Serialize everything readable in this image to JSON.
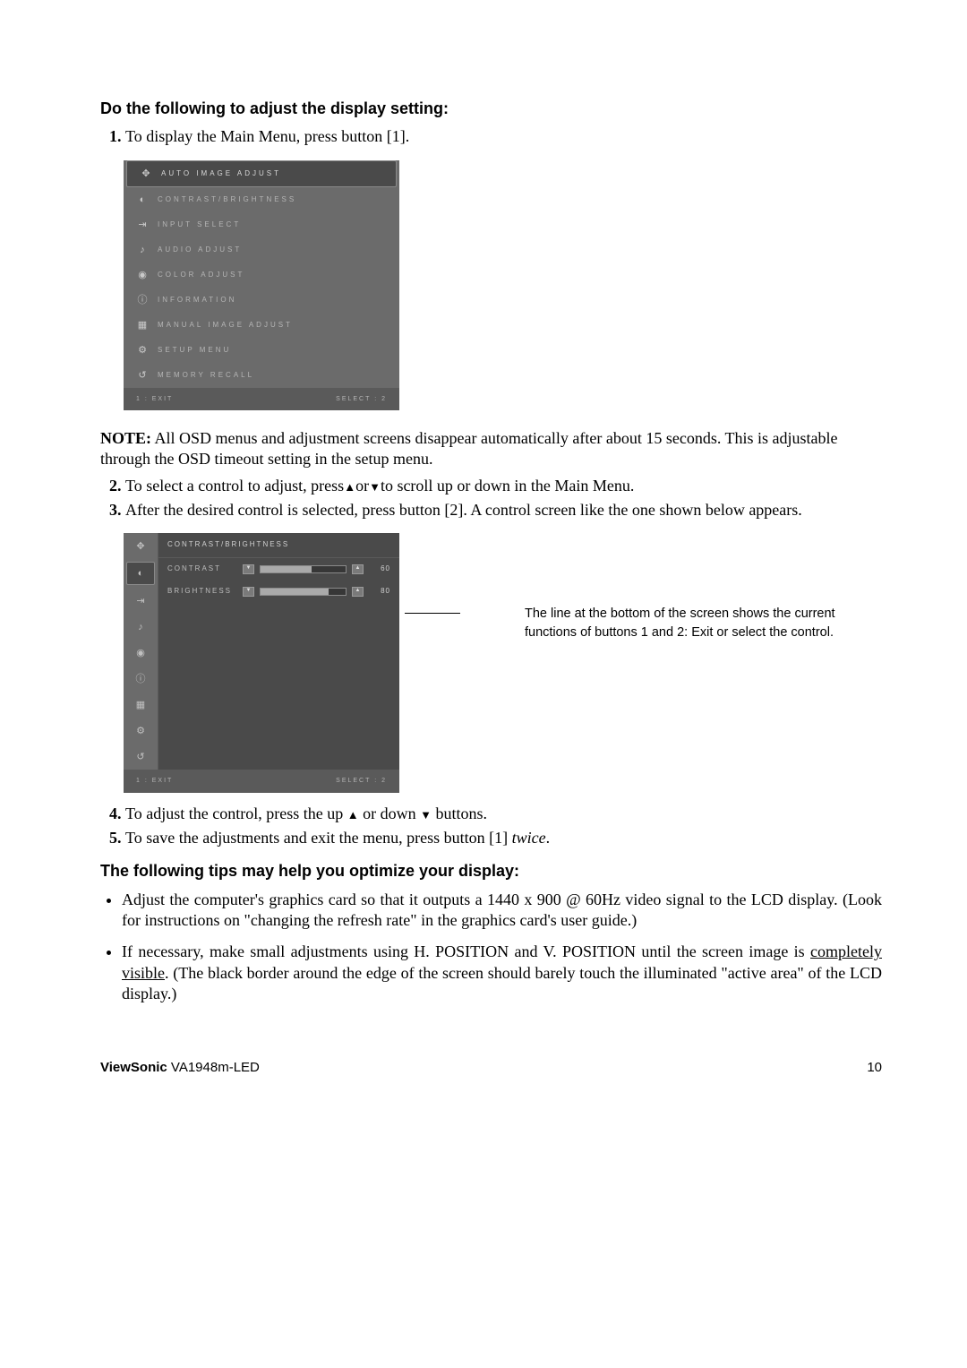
{
  "headings": {
    "adjust": "Do the following to adjust the display setting:",
    "tips": "The following tips may help you optimize your display:"
  },
  "steps": {
    "s1": "To display the Main Menu, press button [1].",
    "s2_a": "To select a control to adjust, press",
    "s2_b": "or",
    "s2_c": "to scroll up or down in the Main Menu.",
    "s3": "After the desired control is selected, press button [2]. A control screen like the one shown below appears.",
    "s4_a": "To adjust the control, press the up ",
    "s4_b": " or down ",
    "s4_c": " buttons.",
    "s5_a": "To save the adjustments and exit the menu, press button [1] ",
    "s5_b": "twice",
    "s5_c": "."
  },
  "note": {
    "label": "NOTE:",
    "text": " All OSD menus and adjustment screens disappear automatically after about 15 seconds. This is adjustable through the OSD timeout setting in the setup menu."
  },
  "osd1": {
    "items": [
      {
        "icon": "✥",
        "label": "AUTO IMAGE ADJUST",
        "selected": true
      },
      {
        "icon": "◐",
        "label": "CONTRAST/BRIGHTNESS"
      },
      {
        "icon": "⇥",
        "label": "INPUT SELECT"
      },
      {
        "icon": "♪",
        "label": "AUDIO ADJUST"
      },
      {
        "icon": "◉",
        "label": "COLOR ADJUST"
      },
      {
        "icon": "ⓘ",
        "label": "INFORMATION"
      },
      {
        "icon": "▦",
        "label": "MANUAL IMAGE ADJUST"
      },
      {
        "icon": "⚙",
        "label": "SETUP MENU"
      },
      {
        "icon": "↺",
        "label": "MEMORY RECALL"
      }
    ],
    "footer_left": "1 : EXIT",
    "footer_right": "SELECT : 2"
  },
  "osd2": {
    "sidebar_icons": [
      "✥",
      "◐",
      "⇥",
      "♪",
      "◉",
      "ⓘ",
      "▦",
      "⚙",
      "↺"
    ],
    "title": "CONTRAST/BRIGHTNESS",
    "rows": [
      {
        "label": "CONTRAST",
        "value": "60"
      },
      {
        "label": "BRIGHTNESS",
        "value": "80"
      }
    ],
    "footer_left": "1 : EXIT",
    "footer_right": "SELECT : 2"
  },
  "callout": "The line at the bottom of the screen shows the current functions of buttons 1 and 2: Exit or select the control.",
  "tips": {
    "t1": "Adjust the computer's graphics card so that it outputs a 1440 x 900 @ 60Hz video signal to the LCD display. (Look for instructions on \"changing the refresh rate\" in the graphics card's user guide.)",
    "t2_a": "If necessary, make small adjustments using H. POSITION and V. POSITION until the screen image is ",
    "t2_u": "completely visible",
    "t2_b": ". (The black border around the edge of the screen should barely touch the illuminated \"active area\" of the LCD display.)"
  },
  "footer": {
    "brand": "ViewSonic",
    "model": "   VA1948m-LED",
    "page": "10"
  }
}
